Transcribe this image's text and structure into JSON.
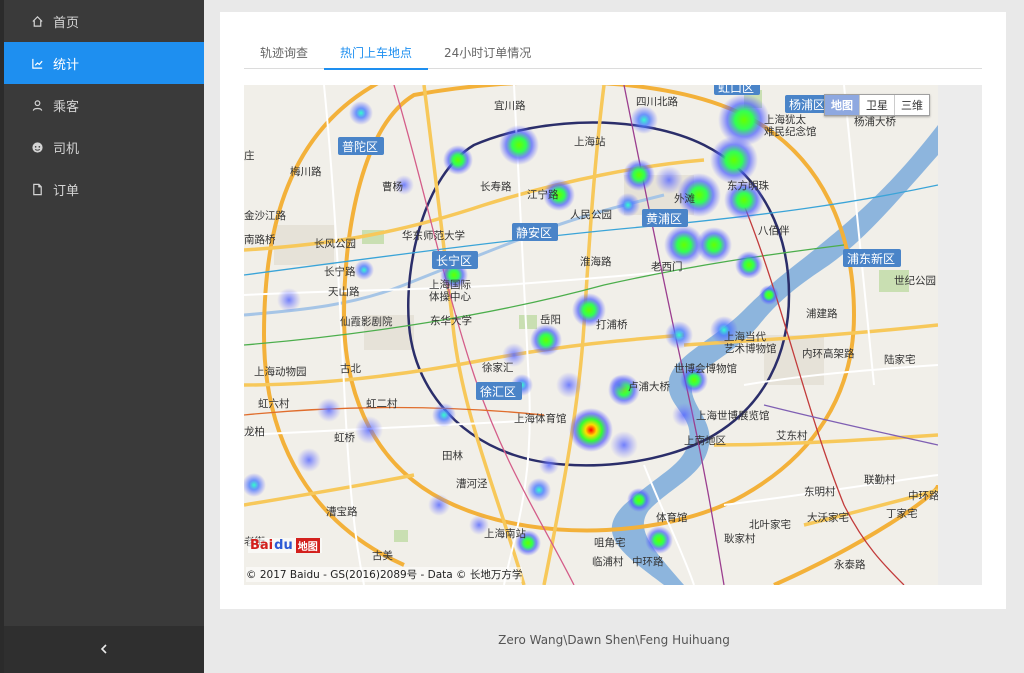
{
  "sidebar": {
    "items": [
      {
        "label": "首页",
        "icon": "home-icon",
        "active": false
      },
      {
        "label": "统计",
        "icon": "chart-icon",
        "active": true
      },
      {
        "label": "乘客",
        "icon": "user-icon",
        "active": false
      },
      {
        "label": "司机",
        "icon": "driver-icon",
        "active": false
      },
      {
        "label": "订单",
        "icon": "file-icon",
        "active": false
      }
    ],
    "collapse_icon": "chevron-left-icon"
  },
  "tabs": [
    {
      "label": "轨迹询查",
      "active": false
    },
    {
      "label": "热门上车地点",
      "active": true
    },
    {
      "label": "24小时订单情况",
      "active": false
    }
  ],
  "map": {
    "type_control": {
      "map": "地图",
      "satellite": "卫星",
      "three_d": "三维",
      "selected": "地图"
    },
    "logo": {
      "brand_a": "Bai",
      "brand_paw": "du",
      "brand_b": "地图"
    },
    "copyright": "© 2017 Baidu - GS(2016)2089号 - Data © 长地万方学",
    "district_labels": [
      "普陀区",
      "静安区",
      "长宁区",
      "黄浦区",
      "徐汇区",
      "杨浦区",
      "虹口区",
      "浦东新区"
    ],
    "place_labels": [
      "梅川路",
      "曹杨",
      "宜川路",
      "四川北路",
      "上海站",
      "长寿路",
      "江宁路",
      "人民公园",
      "外滩",
      "东方明珠",
      "金沙江路",
      "华东师范大学",
      "长风公园",
      "长宁路",
      "天山路",
      "上海国际体操中心",
      "仙霞影剧院",
      "东华大学",
      "淮海路",
      "老西门",
      "岳阳",
      "打浦桥",
      "徐家汇",
      "古北",
      "上海动物园",
      "虹六村",
      "虹二村",
      "虹桥",
      "龙柏",
      "田林",
      "漕河泾",
      "漕宝路",
      "上海南站",
      "古美",
      "上海体育馆",
      "卢浦大桥",
      "世博会博物馆",
      "上海世博展览馆",
      "上南地区",
      "上海当代艺术博物馆",
      "浦建路",
      "内环高架路",
      "陆家宅",
      "艾东村",
      "东明村",
      "联勤村",
      "大沃家宅",
      "丁家宅",
      "中环路",
      "北叶家宅",
      "耿家村",
      "咀角宅",
      "临浦村",
      "永泰路",
      "体育馆",
      "上海犹太难民纪念馆",
      "杨浦大桥",
      "八佰伴",
      "世纪公园",
      "庄",
      "南路桥",
      "老街"
    ]
  },
  "footer": {
    "text": "Zero Wang\\Dawn Shen\\Feng Huihuang"
  },
  "colors": {
    "accent": "#1e8ff0",
    "sidebar_bg": "#3a3a3a",
    "page_bg": "#e9e9e9"
  }
}
